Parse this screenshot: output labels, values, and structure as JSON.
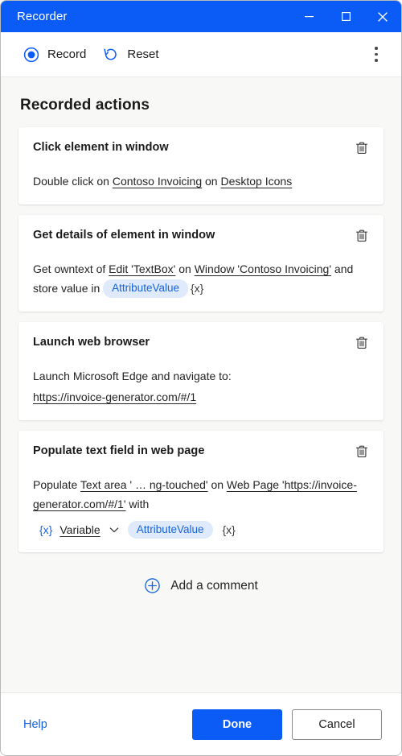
{
  "window": {
    "title": "Recorder",
    "controls": {
      "minimize": "minimize-icon",
      "maximize": "maximize-icon",
      "close": "close-icon"
    }
  },
  "toolbar": {
    "record_label": "Record",
    "reset_label": "Reset",
    "overflow_label": "More options"
  },
  "main": {
    "section_title": "Recorded actions",
    "cards": [
      {
        "title": "Click element in window",
        "delete_label": "Delete",
        "segments": [
          {
            "text": "Double click on ",
            "style": "plain"
          },
          {
            "text": "Contoso Invoicing",
            "style": "underline"
          },
          {
            "text": " on ",
            "style": "plain"
          },
          {
            "text": "Desktop Icons",
            "style": "underline"
          }
        ]
      },
      {
        "title": "Get details of element in window",
        "delete_label": "Delete",
        "segments": [
          {
            "text": "Get owntext of ",
            "style": "plain"
          },
          {
            "text": "Edit 'TextBox'",
            "style": "underline"
          },
          {
            "text": " on ",
            "style": "plain"
          },
          {
            "text": "Window 'Contoso Invoicing'",
            "style": "underline"
          },
          {
            "text": " and store value in ",
            "style": "plain"
          },
          {
            "text": "AttributeValue",
            "style": "chip"
          },
          {
            "text": "{x}",
            "style": "varx"
          }
        ]
      },
      {
        "title": "Launch web browser",
        "delete_label": "Delete",
        "segments": [
          {
            "text": "Launch Microsoft Edge and navigate to:",
            "style": "plain"
          },
          {
            "text": "https://invoice-generator.com/#/1",
            "style": "underline-block"
          }
        ]
      },
      {
        "title": "Populate text field in web page",
        "delete_label": "Delete",
        "segments": [
          {
            "text": "Populate ",
            "style": "plain"
          },
          {
            "text": "Text area ' …  ng-touched'",
            "style": "underline"
          },
          {
            "text": " on ",
            "style": "plain"
          },
          {
            "text": "Web Page 'https://invoice-generator.com/#/1'",
            "style": "underline"
          },
          {
            "text": " with",
            "style": "plain"
          }
        ],
        "variable_row": {
          "prefix_token": "{x}",
          "selector_label": "Variable",
          "chevron": "chevron-down-icon",
          "chip": "AttributeValue",
          "suffix_token": "{x}"
        }
      }
    ],
    "add_comment_label": "Add a comment"
  },
  "footer": {
    "help_label": "Help",
    "done_label": "Done",
    "cancel_label": "Cancel"
  },
  "colors": {
    "accent": "#0b5cf6",
    "link": "#1464e0",
    "chip_bg": "#dfeafc",
    "content_bg": "#f8f8f7",
    "card_bg": "#ffffff",
    "text": "#242424"
  }
}
